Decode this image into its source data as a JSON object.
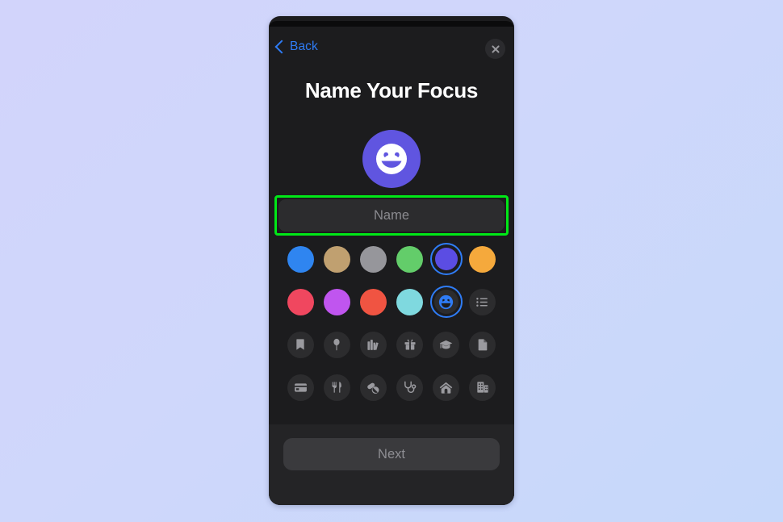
{
  "background": {
    "gradient_start": "#d2d4fb",
    "gradient_end": "#c6d8fa"
  },
  "device": {
    "frame_color": "#1c1c1e",
    "screen_background": "#1c1c1e"
  },
  "nav": {
    "back_label": "Back",
    "back_color": "#2f7cf6",
    "back_icon": "chevron-left-icon",
    "close_icon": "close-icon"
  },
  "header": {
    "title": "Name Your Focus"
  },
  "avatar": {
    "icon": "smiley-face-icon",
    "background_color": "#6055e0",
    "glyph_color": "#ffffff"
  },
  "name_field": {
    "value": "",
    "placeholder": "Name",
    "highlight_color": "#00e817",
    "background_color": "#2c2c2e"
  },
  "picker": {
    "selection_ring_color": "#2f7cf6",
    "rows": [
      {
        "row_name": "color-row-1",
        "items": [
          {
            "name": "color-swatch-blue",
            "kind": "color",
            "color": "#2f85f0",
            "selected": false
          },
          {
            "name": "color-swatch-tan",
            "kind": "color",
            "color": "#c0a070",
            "selected": false
          },
          {
            "name": "color-swatch-gray",
            "kind": "color",
            "color": "#96969b",
            "selected": false
          },
          {
            "name": "color-swatch-green",
            "kind": "color",
            "color": "#63cd6a",
            "selected": false
          },
          {
            "name": "color-swatch-purple",
            "kind": "color",
            "color": "#5b4de3",
            "selected": true
          },
          {
            "name": "color-swatch-orange",
            "kind": "color",
            "color": "#f5a93c",
            "selected": false
          }
        ]
      },
      {
        "row_name": "color-row-2",
        "items": [
          {
            "name": "color-swatch-pink",
            "kind": "color",
            "color": "#f0475f",
            "selected": false
          },
          {
            "name": "color-swatch-magenta",
            "kind": "color",
            "color": "#c055ef",
            "selected": false
          },
          {
            "name": "color-swatch-red",
            "kind": "color",
            "color": "#f05442",
            "selected": false
          },
          {
            "name": "color-swatch-cyan",
            "kind": "color",
            "color": "#7fd9df",
            "selected": false
          },
          {
            "name": "icon-swatch-smiley",
            "kind": "icon",
            "icon": "smiley-face-icon",
            "glyph_color": "#2f7cf6",
            "selected": true
          },
          {
            "name": "icon-swatch-list",
            "kind": "icon",
            "icon": "bullet-list-icon",
            "glyph_color": "#9a9a9f",
            "selected": false
          }
        ]
      },
      {
        "row_name": "icon-row-1",
        "items": [
          {
            "name": "icon-swatch-bookmark",
            "kind": "icon",
            "icon": "bookmark-icon",
            "glyph_color": "#9a9a9f",
            "selected": false
          },
          {
            "name": "icon-swatch-balloon",
            "kind": "icon",
            "icon": "balloon-icon",
            "glyph_color": "#9a9a9f",
            "selected": false
          },
          {
            "name": "icon-swatch-books",
            "kind": "icon",
            "icon": "books-icon",
            "glyph_color": "#9a9a9f",
            "selected": false
          },
          {
            "name": "icon-swatch-gift",
            "kind": "icon",
            "icon": "gift-icon",
            "glyph_color": "#9a9a9f",
            "selected": false
          },
          {
            "name": "icon-swatch-graduation",
            "kind": "icon",
            "icon": "graduation-cap-icon",
            "glyph_color": "#9a9a9f",
            "selected": false
          },
          {
            "name": "icon-swatch-document",
            "kind": "icon",
            "icon": "document-icon",
            "glyph_color": "#9a9a9f",
            "selected": false
          }
        ]
      },
      {
        "row_name": "icon-row-2",
        "items": [
          {
            "name": "icon-swatch-creditcard",
            "kind": "icon",
            "icon": "credit-card-icon",
            "glyph_color": "#9a9a9f",
            "selected": false
          },
          {
            "name": "icon-swatch-fork-knife",
            "kind": "icon",
            "icon": "fork-knife-icon",
            "glyph_color": "#9a9a9f",
            "selected": false
          },
          {
            "name": "icon-swatch-pills",
            "kind": "icon",
            "icon": "pills-icon",
            "glyph_color": "#9a9a9f",
            "selected": false
          },
          {
            "name": "icon-swatch-stethoscope",
            "kind": "icon",
            "icon": "stethoscope-icon",
            "glyph_color": "#9a9a9f",
            "selected": false
          },
          {
            "name": "icon-swatch-house",
            "kind": "icon",
            "icon": "house-icon",
            "glyph_color": "#9a9a9f",
            "selected": false
          },
          {
            "name": "icon-swatch-building",
            "kind": "icon",
            "icon": "building-icon",
            "glyph_color": "#9a9a9f",
            "selected": false
          }
        ]
      }
    ]
  },
  "footer": {
    "next_label": "Next",
    "next_enabled": false
  }
}
